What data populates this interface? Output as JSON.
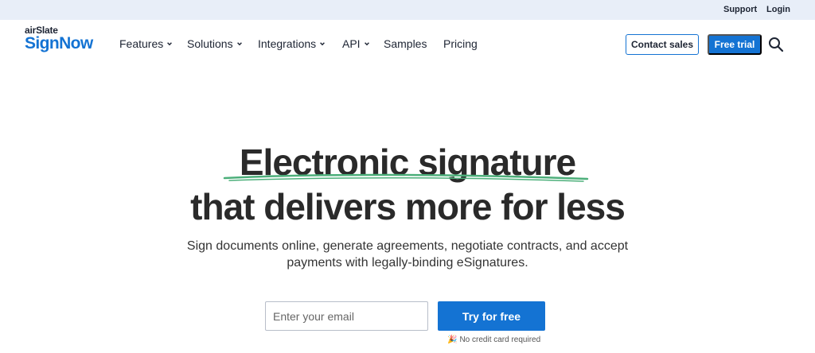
{
  "topbar": {
    "support": "Support",
    "login": "Login"
  },
  "logo": {
    "prefix": "airSlate",
    "name": "SignNow"
  },
  "nav": {
    "items": [
      {
        "label": "Features",
        "has_dropdown": true
      },
      {
        "label": "Solutions",
        "has_dropdown": true
      },
      {
        "label": "Integrations",
        "has_dropdown": true
      },
      {
        "label": "API",
        "has_dropdown": true
      },
      {
        "label": "Samples",
        "has_dropdown": false
      },
      {
        "label": "Pricing",
        "has_dropdown": false
      }
    ],
    "contact_sales": "Contact sales",
    "free_trial": "Free trial",
    "search_icon": "search-icon"
  },
  "hero": {
    "title_line1": "Electronic signature",
    "title_line2": "that delivers more for less",
    "subtitle_line1": "Sign documents online, generate agreements, negotiate contracts, and accept",
    "subtitle_line2": "payments with legally-binding eSignatures.",
    "email_placeholder": "Enter your email",
    "email_value": "",
    "cta": "Try for free",
    "note": "No credit card required",
    "note_icon": "party-popper-icon"
  },
  "colors": {
    "accent": "#1473d3",
    "topbar_bg": "#e8eef8",
    "underline": "#4caf7a",
    "text_dark": "#2a2a2a"
  }
}
